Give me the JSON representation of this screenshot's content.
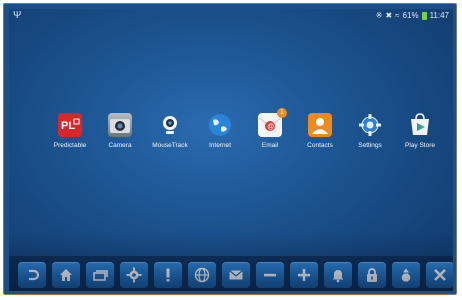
{
  "statusbar": {
    "left_icon": "usb-icon",
    "battery_percent": "61%",
    "time": "11:47"
  },
  "apps": [
    {
      "label": "Predictable",
      "icon": "predictable-icon",
      "color": "#d9262b"
    },
    {
      "label": "Camera",
      "icon": "camera-icon",
      "color": "#8a8f96"
    },
    {
      "label": "MouseTrack",
      "icon": "webcam-icon",
      "color": "#e8eef5"
    },
    {
      "label": "Internet",
      "icon": "globe-icon",
      "color": "#1f74c8"
    },
    {
      "label": "Email",
      "icon": "email-icon",
      "color": "#e04040",
      "badge": "1"
    },
    {
      "label": "Contacts",
      "icon": "contacts-icon",
      "color": "#f08a1c"
    },
    {
      "label": "Settings",
      "icon": "gear-icon",
      "color": "#2f7fd6"
    },
    {
      "label": "Play Store",
      "icon": "play-store-icon",
      "color": "#f3f3f3"
    }
  ],
  "taskbar": [
    {
      "name": "back-icon"
    },
    {
      "name": "home-icon"
    },
    {
      "name": "recent-apps-icon"
    },
    {
      "name": "gear-icon"
    },
    {
      "name": "exclamation-icon"
    },
    {
      "name": "globe-icon"
    },
    {
      "name": "mail-icon"
    },
    {
      "name": "minus-icon"
    },
    {
      "name": "plus-icon"
    },
    {
      "name": "bell-icon"
    },
    {
      "name": "lock-icon"
    },
    {
      "name": "drop-icon"
    },
    {
      "name": "close-icon"
    }
  ]
}
